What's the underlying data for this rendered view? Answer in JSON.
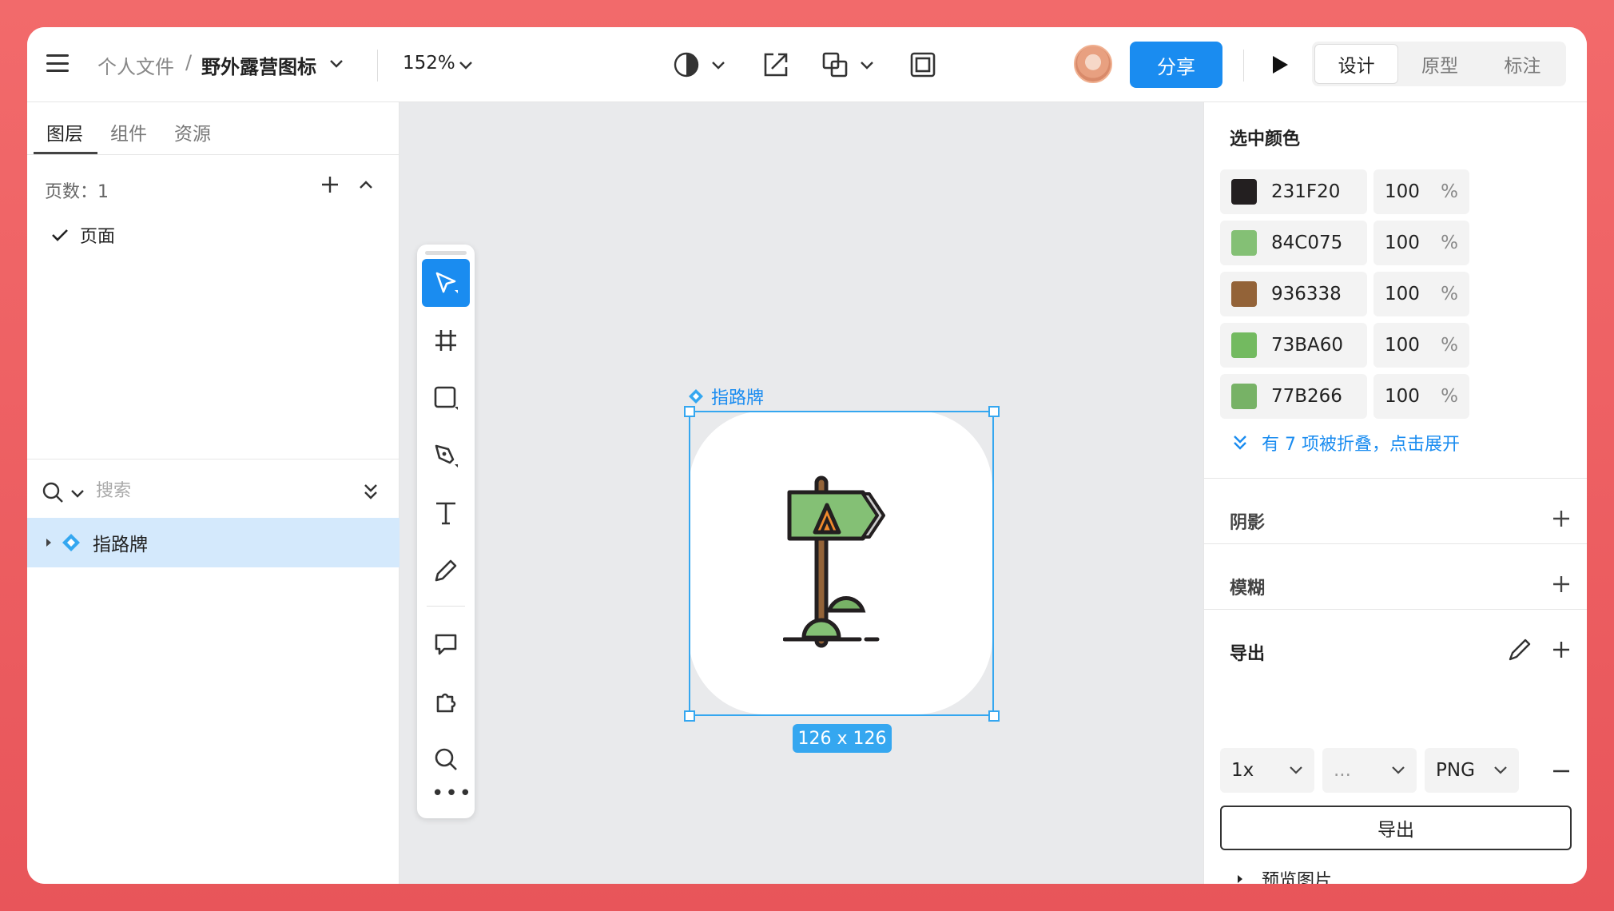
{
  "topbar": {
    "breadcrumb_root": "个人文件",
    "breadcrumb_sep": "/",
    "file_name": "野外露营图标",
    "zoom": "152%",
    "share_label": "分享",
    "mode_tabs": [
      "设计",
      "原型",
      "标注"
    ],
    "active_mode": "设计"
  },
  "left_panel": {
    "tabs": [
      "图层",
      "组件",
      "资源"
    ],
    "active_tab": "图层",
    "pages_label": "页数：1",
    "pages": [
      {
        "label": "页面",
        "checked": true
      }
    ],
    "search_placeholder": "搜索",
    "layers": [
      {
        "label": "指路牌",
        "selected": true
      }
    ]
  },
  "canvas": {
    "frame_label": "指路牌",
    "size_badge": "126 x 126",
    "tools": [
      "move-tool",
      "frame-tool",
      "shape-tool",
      "pen-tool",
      "text-tool",
      "pencil-tool",
      "comment-tool",
      "plugin-tool",
      "search-tool"
    ]
  },
  "right_panel": {
    "selected_colors_title": "选中颜色",
    "colors": [
      {
        "hex": "231F20",
        "opacity": "100",
        "swatch": "#231F20"
      },
      {
        "hex": "84C075",
        "opacity": "100",
        "swatch": "#84C075"
      },
      {
        "hex": "936338",
        "opacity": "100",
        "swatch": "#936338"
      },
      {
        "hex": "73BA60",
        "opacity": "100",
        "swatch": "#73BA60"
      },
      {
        "hex": "77B266",
        "opacity": "100",
        "swatch": "#77B266"
      }
    ],
    "percent_sign": "%",
    "collapsed_note": "有 7 项被折叠，点击展开",
    "shadow_title": "阴影",
    "blur_title": "模糊",
    "export_title": "导出",
    "export_scale": "1x",
    "export_suffix": "...",
    "export_format": "PNG",
    "export_button": "导出",
    "preview_label": "预览图片"
  },
  "theme": {
    "accent": "#1a8cf0",
    "selection": "#35a7f0",
    "layer_highlight": "#d4e9fc",
    "background": "#e8555a"
  }
}
